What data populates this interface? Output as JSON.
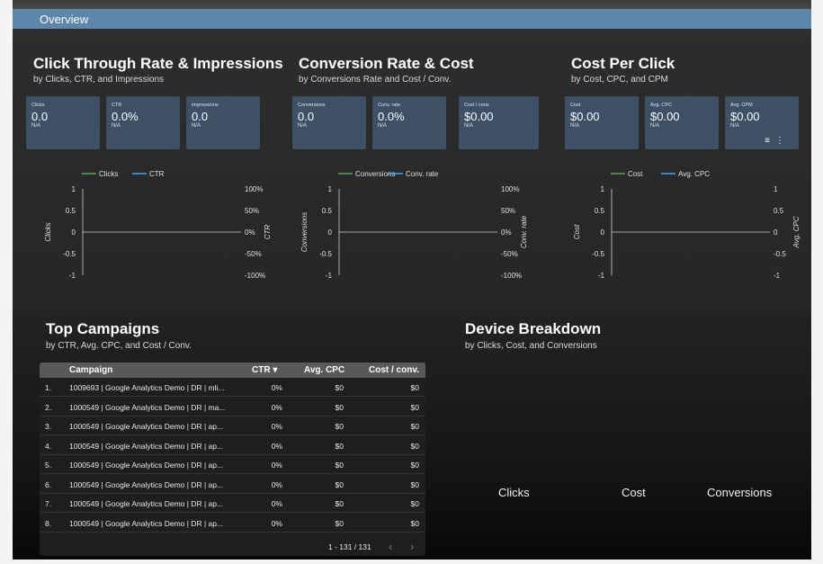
{
  "overview": "Overview",
  "sections": [
    {
      "title": "Click Through Rate & Impressions",
      "subtitle": "by Clicks, CTR, and Impressions",
      "cards": [
        {
          "label": "Clicks",
          "value": "0.0",
          "change": "N/A"
        },
        {
          "label": "CTR",
          "value": "0.0%",
          "change": "N/A"
        },
        {
          "label": "Impressions",
          "value": "0.0",
          "change": "N/A"
        }
      ],
      "chart": {
        "legend": [
          {
            "name": "Clicks",
            "color": "#4caf50"
          },
          {
            "name": "CTR",
            "color": "#42a5f5"
          }
        ],
        "left_axis_title": "Clicks",
        "right_axis_title": "CTR",
        "left_ticks": [
          "1",
          "0.5",
          "0",
          "-0.5",
          "-1"
        ],
        "right_ticks": [
          "100%",
          "50%",
          "0%",
          "-50%",
          "-100%"
        ]
      }
    },
    {
      "title": "Conversion Rate & Cost",
      "subtitle": "by Conversions Rate and Cost / Conv.",
      "cards": [
        {
          "label": "Conversions",
          "value": "0.0",
          "change": "N/A"
        },
        {
          "label": "Conv. rate",
          "value": "0.0%",
          "change": "N/A"
        },
        {
          "label": "Cost / conv.",
          "value": "$0.00",
          "change": "N/A"
        }
      ],
      "chart": {
        "legend": [
          {
            "name": "Conversions",
            "color": "#4caf50"
          },
          {
            "name": "Conv. rate",
            "color": "#42a5f5"
          }
        ],
        "left_axis_title": "Conversions",
        "right_axis_title": "Conv. rate",
        "left_ticks": [
          "1",
          "0.5",
          "0",
          "-0.5",
          "-1"
        ],
        "right_ticks": [
          "100%",
          "50%",
          "0%",
          "-50%",
          "-100%"
        ]
      }
    },
    {
      "title": "Cost Per Click",
      "subtitle": "by Cost, CPC, and CPM",
      "cards": [
        {
          "label": "Cost",
          "value": "$0.00",
          "change": "N/A"
        },
        {
          "label": "Avg. CPC",
          "value": "$0.00",
          "change": "N/A"
        },
        {
          "label": "Avg. CPM",
          "value": "$0.00",
          "change": "N/A"
        }
      ],
      "chart": {
        "legend": [
          {
            "name": "Cost",
            "color": "#4caf50"
          },
          {
            "name": "Avg. CPC",
            "color": "#42a5f5"
          }
        ],
        "left_axis_title": "Cost",
        "right_axis_title": "Avg. CPC",
        "left_ticks": [
          "1",
          "0.5",
          "0",
          "-0.5",
          "-1"
        ],
        "right_ticks": [
          "1",
          "0.5",
          "0",
          "-0.5",
          "-1"
        ]
      }
    }
  ],
  "campaigns": {
    "title": "Top Campaigns",
    "subtitle": "by CTR, Avg. CPC, and Cost / Conv.",
    "columns": [
      "Campaign",
      "CTR ▾",
      "Avg. CPC",
      "Cost / conv."
    ],
    "rows": [
      [
        "1.",
        "1009693 | Google Analytics Demo | DR | mli...",
        "0%",
        "$0",
        "$0"
      ],
      [
        "2.",
        "1000549 | Google Analytics Demo | DR | ma...",
        "0%",
        "$0",
        "$0"
      ],
      [
        "3.",
        "1000549 | Google Analytics Demo | DR | ap...",
        "0%",
        "$0",
        "$0"
      ],
      [
        "4.",
        "1000549 | Google Analytics Demo | DR | ap...",
        "0%",
        "$0",
        "$0"
      ],
      [
        "5.",
        "1000549 | Google Analytics Demo | DR | ap...",
        "0%",
        "$0",
        "$0"
      ],
      [
        "6.",
        "1000549 | Google Analytics Demo | DR | ap...",
        "0%",
        "$0",
        "$0"
      ],
      [
        "7.",
        "1000549 | Google Analytics Demo | DR | ap...",
        "0%",
        "$0",
        "$0"
      ],
      [
        "8.",
        "1000549 | Google Analytics Demo | DR | ap...",
        "0%",
        "$0",
        "$0"
      ]
    ],
    "pagination": "1 - 131 / 131"
  },
  "device": {
    "title": "Device Breakdown",
    "subtitle": "by Clicks, Cost, and Conversions",
    "labels": [
      "Clicks",
      "Cost",
      "Conversions"
    ]
  },
  "colors": {
    "overview_bar": "#5c87aa",
    "card_bg": "#3d5066",
    "primary_line": "#4caf50",
    "secondary_line": "#42a5f5"
  }
}
